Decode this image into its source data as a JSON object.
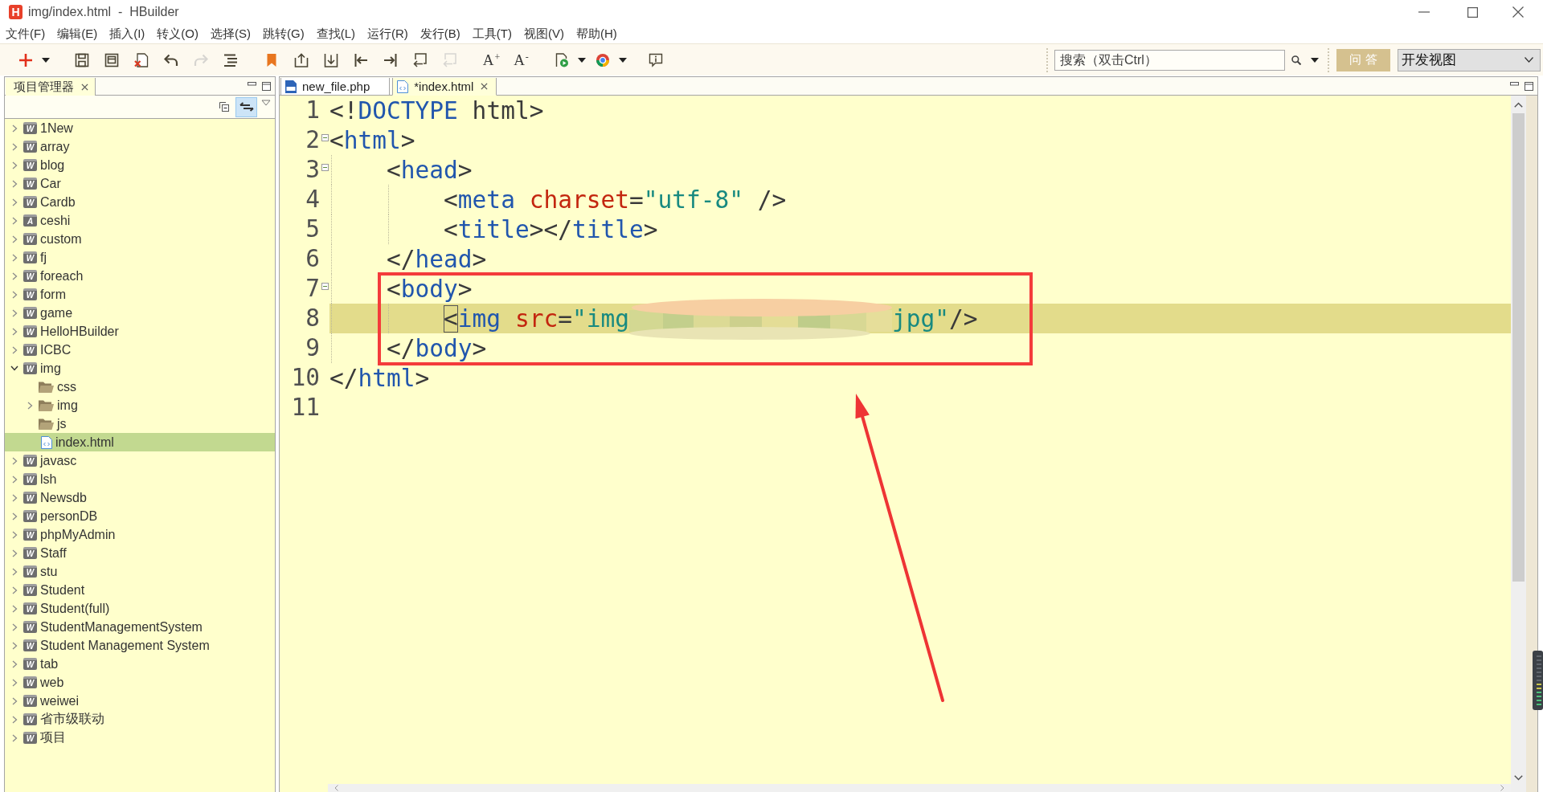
{
  "window": {
    "app_icon": "H",
    "title": "img/index.html  -  HBuilder"
  },
  "menu": [
    "文件(F)",
    "编辑(E)",
    "插入(I)",
    "转义(O)",
    "选择(S)",
    "跳转(G)",
    "查找(L)",
    "运行(R)",
    "发行(B)",
    "工具(T)",
    "视图(V)",
    "帮助(H)"
  ],
  "toolbar": [
    {
      "kind": "new",
      "disabled": false,
      "menu": true
    },
    {
      "kind": "save",
      "disabled": false
    },
    {
      "kind": "save-all",
      "disabled": false
    },
    {
      "kind": "close-all",
      "disabled": false
    },
    {
      "kind": "undo",
      "disabled": false
    },
    {
      "kind": "redo",
      "disabled": true
    },
    {
      "kind": "format",
      "disabled": false
    },
    {
      "kind": "bookmark",
      "disabled": false
    },
    {
      "kind": "prev",
      "disabled": false
    },
    {
      "kind": "next",
      "disabled": false
    },
    {
      "kind": "line-start",
      "disabled": false
    },
    {
      "kind": "line-end",
      "disabled": false
    },
    {
      "kind": "back",
      "disabled": false
    },
    {
      "kind": "forward",
      "disabled": true
    },
    {
      "kind": "font-up",
      "label": "A+",
      "disabled": false
    },
    {
      "kind": "font-down",
      "label": "A-",
      "disabled": false
    },
    {
      "kind": "run",
      "disabled": false,
      "menu": true
    },
    {
      "kind": "browser",
      "disabled": false,
      "menu": true
    },
    {
      "kind": "info",
      "disabled": false
    }
  ],
  "search": {
    "placeholder": "搜索（双击Ctrl）"
  },
  "qa_button": "问 答",
  "view_select": {
    "value": "开发视图"
  },
  "sidebar": {
    "tab": "项目管理器",
    "tools": [
      {
        "kind": "collapse",
        "on": false
      },
      {
        "kind": "link",
        "on": true
      }
    ],
    "tree": [
      {
        "kind": "project",
        "badge": "W",
        "label": "1New",
        "expanded": false,
        "selected": false
      },
      {
        "kind": "project",
        "badge": "W",
        "label": "array",
        "expanded": false,
        "selected": false
      },
      {
        "kind": "project",
        "badge": "W",
        "label": "blog",
        "expanded": false,
        "selected": false
      },
      {
        "kind": "project",
        "badge": "W",
        "label": "Car",
        "expanded": false,
        "selected": false
      },
      {
        "kind": "project",
        "badge": "W",
        "label": "Cardb",
        "expanded": false,
        "selected": false
      },
      {
        "kind": "project",
        "badge": "A",
        "label": "ceshi",
        "expanded": false,
        "selected": false
      },
      {
        "kind": "project",
        "badge": "W",
        "label": "custom",
        "expanded": false,
        "selected": false
      },
      {
        "kind": "project",
        "badge": "W",
        "label": "fj",
        "expanded": false,
        "selected": false
      },
      {
        "kind": "project",
        "badge": "W",
        "label": "foreach",
        "expanded": false,
        "selected": false
      },
      {
        "kind": "project",
        "badge": "W",
        "label": "form",
        "expanded": false,
        "selected": false
      },
      {
        "kind": "project",
        "badge": "W",
        "label": "game",
        "expanded": false,
        "selected": false
      },
      {
        "kind": "project",
        "badge": "W",
        "label": "HelloHBuilder",
        "expanded": false,
        "selected": false
      },
      {
        "kind": "project",
        "badge": "W",
        "label": "ICBC",
        "expanded": false,
        "selected": false
      },
      {
        "kind": "project",
        "badge": "W",
        "label": "img",
        "expanded": true,
        "selected": false,
        "children": [
          {
            "kind": "folder",
            "label": "css",
            "selected": false
          },
          {
            "kind": "folder",
            "label": "img",
            "expanded": false,
            "selected": false
          },
          {
            "kind": "folder",
            "label": "js",
            "selected": false
          },
          {
            "kind": "file",
            "label": "index.html",
            "selected": true
          }
        ]
      },
      {
        "kind": "project",
        "badge": "W",
        "label": "javasc",
        "expanded": false,
        "selected": false
      },
      {
        "kind": "project",
        "badge": "W",
        "label": "lsh",
        "expanded": false,
        "selected": false
      },
      {
        "kind": "project",
        "badge": "W",
        "label": "Newsdb",
        "expanded": false,
        "selected": false
      },
      {
        "kind": "project",
        "badge": "W",
        "label": "personDB",
        "expanded": false,
        "selected": false
      },
      {
        "kind": "project",
        "badge": "W",
        "label": "phpMyAdmin",
        "expanded": false,
        "selected": false
      },
      {
        "kind": "project",
        "badge": "W",
        "label": "Staff",
        "expanded": false,
        "selected": false
      },
      {
        "kind": "project",
        "badge": "W",
        "label": "stu",
        "expanded": false,
        "selected": false
      },
      {
        "kind": "project",
        "badge": "W",
        "label": "Student",
        "expanded": false,
        "selected": false
      },
      {
        "kind": "project",
        "badge": "W",
        "label": "Student(full)",
        "expanded": false,
        "selected": false
      },
      {
        "kind": "project",
        "badge": "W",
        "label": "StudentManagementSystem",
        "expanded": false,
        "selected": false
      },
      {
        "kind": "project",
        "badge": "W",
        "label": "Student Management System",
        "expanded": false,
        "selected": false
      },
      {
        "kind": "project",
        "badge": "W",
        "label": "tab",
        "expanded": false,
        "selected": false
      },
      {
        "kind": "project",
        "badge": "W",
        "label": "web",
        "expanded": false,
        "selected": false
      },
      {
        "kind": "project",
        "badge": "W",
        "label": "weiwei",
        "expanded": false,
        "selected": false
      },
      {
        "kind": "project",
        "badge": "W",
        "label": "省市级联动",
        "expanded": false,
        "selected": false
      },
      {
        "kind": "project",
        "badge": "W",
        "label": "项目",
        "expanded": false,
        "selected": false
      }
    ]
  },
  "editor": {
    "tabs": [
      {
        "kind": "php",
        "label": "new_file.php",
        "selected": false
      },
      {
        "kind": "html",
        "label": "*index.html",
        "selected": true
      }
    ],
    "lines": [
      {
        "number": "1",
        "current": false,
        "foldable": false,
        "tokens": [
          {
            "kind": "punct",
            "text": "<!"
          },
          {
            "kind": "tag",
            "text": "DOCTYPE"
          },
          {
            "kind": "punct",
            "text": " html>"
          }
        ]
      },
      {
        "number": "2",
        "current": false,
        "foldable": true,
        "tokens": [
          {
            "kind": "punct",
            "text": "<"
          },
          {
            "kind": "tag",
            "text": "html"
          },
          {
            "kind": "punct",
            "text": ">"
          }
        ]
      },
      {
        "number": "3",
        "current": false,
        "foldable": true,
        "tokens": [
          {
            "kind": "punct",
            "text": "    <"
          },
          {
            "kind": "tag",
            "text": "head"
          },
          {
            "kind": "punct",
            "text": ">"
          }
        ]
      },
      {
        "number": "4",
        "current": false,
        "foldable": false,
        "tokens": [
          {
            "kind": "punct",
            "text": "        <"
          },
          {
            "kind": "tag",
            "text": "meta"
          },
          {
            "kind": "attr",
            "text": " charset"
          },
          {
            "kind": "punct",
            "text": "="
          },
          {
            "kind": "value",
            "text": "\"utf-8\""
          },
          {
            "kind": "punct",
            "text": " />"
          }
        ]
      },
      {
        "number": "5",
        "current": false,
        "foldable": false,
        "tokens": [
          {
            "kind": "punct",
            "text": "        <"
          },
          {
            "kind": "tag",
            "text": "title"
          },
          {
            "kind": "punct",
            "text": "></"
          },
          {
            "kind": "tag",
            "text": "title"
          },
          {
            "kind": "punct",
            "text": ">"
          }
        ]
      },
      {
        "number": "6",
        "current": false,
        "foldable": false,
        "tokens": [
          {
            "kind": "punct",
            "text": "    </"
          },
          {
            "kind": "tag",
            "text": "head"
          },
          {
            "kind": "punct",
            "text": ">"
          }
        ]
      },
      {
        "number": "7",
        "current": false,
        "foldable": true,
        "tokens": [
          {
            "kind": "punct",
            "text": "    <"
          },
          {
            "kind": "tag",
            "text": "body"
          },
          {
            "kind": "punct",
            "text": ">"
          }
        ]
      },
      {
        "number": "8",
        "current": true,
        "foldable": false,
        "tokens": [
          {
            "kind": "match",
            "text": "        <"
          },
          {
            "kind": "tag",
            "text": "img"
          },
          {
            "kind": "attr",
            "text": " src"
          },
          {
            "kind": "punct",
            "text": "="
          },
          {
            "kind": "value",
            "text": "\"img"
          },
          {
            "kind": "redacted"
          },
          {
            "kind": "value",
            "text": "jpg\""
          },
          {
            "kind": "punct",
            "text": "/>"
          }
        ]
      },
      {
        "number": "9",
        "current": false,
        "foldable": false,
        "tokens": [
          {
            "kind": "punct",
            "text": "    </"
          },
          {
            "kind": "tag",
            "text": "body"
          },
          {
            "kind": "punct",
            "text": ">"
          }
        ]
      },
      {
        "number": "10",
        "current": false,
        "foldable": false,
        "tokens": [
          {
            "kind": "punct",
            "text": "</"
          },
          {
            "kind": "tag",
            "text": "html"
          },
          {
            "kind": "punct",
            "text": ">"
          }
        ]
      },
      {
        "number": "11",
        "current": false,
        "foldable": false
      }
    ]
  }
}
